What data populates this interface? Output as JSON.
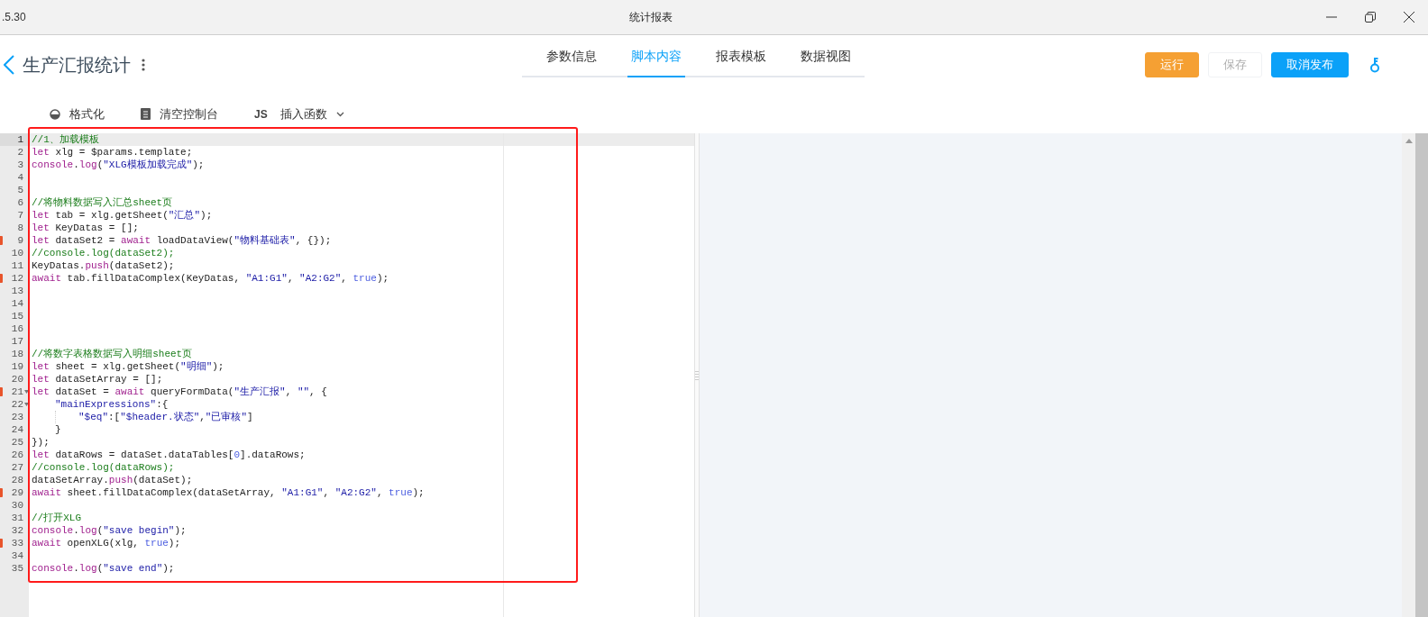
{
  "window": {
    "version": ".5.30",
    "title": "统计报表"
  },
  "header": {
    "title": "生产汇报统计"
  },
  "tabs": [
    {
      "label": "参数信息",
      "selected": false
    },
    {
      "label": "脚本内容",
      "selected": true
    },
    {
      "label": "报表模板",
      "selected": false
    },
    {
      "label": "数据视图",
      "selected": false
    }
  ],
  "buttons": [
    {
      "label": "运行",
      "kind": "warning",
      "disabled": false
    },
    {
      "label": "保存",
      "kind": "default",
      "disabled": true
    },
    {
      "label": "取消发布",
      "kind": "primary",
      "disabled": false
    }
  ],
  "toolbar": [
    {
      "kind": "format",
      "label": "格式化"
    },
    {
      "kind": "clear",
      "label": "清空控制台"
    },
    {
      "kind": "insert",
      "prefix": "JS",
      "label": "插入函数"
    }
  ],
  "editor": {
    "lines": [
      {
        "number": "1",
        "active": true,
        "marked": false,
        "foldable": false,
        "tokens": [
          {
            "kind": "comment",
            "text": "//1、加载模板"
          }
        ]
      },
      {
        "number": "2",
        "active": false,
        "marked": false,
        "foldable": false,
        "tokens": [
          {
            "kind": "keyword",
            "text": "let"
          },
          {
            "kind": "plain",
            "text": " xlg = $params.template;"
          }
        ]
      },
      {
        "number": "3",
        "active": false,
        "marked": false,
        "foldable": false,
        "tokens": [
          {
            "kind": "builtin",
            "text": "console"
          },
          {
            "kind": "plain",
            "text": "."
          },
          {
            "kind": "builtin",
            "text": "log"
          },
          {
            "kind": "plain",
            "text": "("
          },
          {
            "kind": "string",
            "text": "\"XLG模板加载完成\""
          },
          {
            "kind": "plain",
            "text": ");"
          }
        ]
      },
      {
        "number": "4",
        "active": false,
        "marked": false,
        "foldable": false
      },
      {
        "number": "5",
        "active": false,
        "marked": false,
        "foldable": false
      },
      {
        "number": "6",
        "active": false,
        "marked": false,
        "foldable": false,
        "tokens": [
          {
            "kind": "comment",
            "text": "//将物料数据写入汇总sheet页"
          }
        ]
      },
      {
        "number": "7",
        "active": false,
        "marked": false,
        "foldable": false,
        "tokens": [
          {
            "kind": "keyword",
            "text": "let"
          },
          {
            "kind": "plain",
            "text": " tab = xlg.getSheet("
          },
          {
            "kind": "string",
            "text": "\"汇总\""
          },
          {
            "kind": "plain",
            "text": ");"
          }
        ]
      },
      {
        "number": "8",
        "active": false,
        "marked": false,
        "foldable": false,
        "tokens": [
          {
            "kind": "keyword",
            "text": "let"
          },
          {
            "kind": "plain",
            "text": " KeyDatas = [];"
          }
        ]
      },
      {
        "number": "9",
        "active": false,
        "marked": true,
        "foldable": false,
        "tokens": [
          {
            "kind": "keyword",
            "text": "let"
          },
          {
            "kind": "plain",
            "text": " dataSet2 = "
          },
          {
            "kind": "keyword",
            "text": "await"
          },
          {
            "kind": "plain",
            "text": " loadDataView("
          },
          {
            "kind": "string",
            "text": "\"物料基础表\""
          },
          {
            "kind": "plain",
            "text": ", {});"
          }
        ]
      },
      {
        "number": "10",
        "active": false,
        "marked": false,
        "foldable": false,
        "tokens": [
          {
            "kind": "comment",
            "text": "//console.log(dataSet2);"
          }
        ]
      },
      {
        "number": "11",
        "active": false,
        "marked": false,
        "foldable": false,
        "tokens": [
          {
            "kind": "plain",
            "text": "KeyDatas."
          },
          {
            "kind": "builtin",
            "text": "push"
          },
          {
            "kind": "plain",
            "text": "(dataSet2);"
          }
        ]
      },
      {
        "number": "12",
        "active": false,
        "marked": true,
        "foldable": false,
        "tokens": [
          {
            "kind": "keyword",
            "text": "await"
          },
          {
            "kind": "plain",
            "text": " tab.fillDataComplex(KeyDatas, "
          },
          {
            "kind": "string",
            "text": "\"A1:G1\""
          },
          {
            "kind": "plain",
            "text": ", "
          },
          {
            "kind": "string",
            "text": "\"A2:G2\""
          },
          {
            "kind": "plain",
            "text": ", "
          },
          {
            "kind": "literal",
            "text": "true"
          },
          {
            "kind": "plain",
            "text": ");"
          }
        ]
      },
      {
        "number": "13",
        "active": false,
        "marked": false,
        "foldable": false
      },
      {
        "number": "14",
        "active": false,
        "marked": false,
        "foldable": false
      },
      {
        "number": "15",
        "active": false,
        "marked": false,
        "foldable": false
      },
      {
        "number": "16",
        "active": false,
        "marked": false,
        "foldable": false
      },
      {
        "number": "17",
        "active": false,
        "marked": false,
        "foldable": false
      },
      {
        "number": "18",
        "active": false,
        "marked": false,
        "foldable": false,
        "tokens": [
          {
            "kind": "comment",
            "text": "//将数字表格数据写入明细sheet页"
          }
        ]
      },
      {
        "number": "19",
        "active": false,
        "marked": false,
        "foldable": false,
        "tokens": [
          {
            "kind": "keyword",
            "text": "let"
          },
          {
            "kind": "plain",
            "text": " sheet = xlg.getSheet("
          },
          {
            "kind": "string",
            "text": "\"明细\""
          },
          {
            "kind": "plain",
            "text": ");"
          }
        ]
      },
      {
        "number": "20",
        "active": false,
        "marked": false,
        "foldable": false,
        "tokens": [
          {
            "kind": "keyword",
            "text": "let"
          },
          {
            "kind": "plain",
            "text": " dataSetArray = [];"
          }
        ]
      },
      {
        "number": "21",
        "active": false,
        "marked": true,
        "foldable": true,
        "tokens": [
          {
            "kind": "keyword",
            "text": "let"
          },
          {
            "kind": "plain",
            "text": " dataSet = "
          },
          {
            "kind": "keyword",
            "text": "await"
          },
          {
            "kind": "plain",
            "text": " queryFormData("
          },
          {
            "kind": "string",
            "text": "\"生产汇报\""
          },
          {
            "kind": "plain",
            "text": ", "
          },
          {
            "kind": "string",
            "text": "\"\""
          },
          {
            "kind": "plain",
            "text": ", {"
          }
        ],
        "children": [
          {
            "number": "22",
            "active": false,
            "marked": false,
            "foldable": true,
            "tokens": [
              {
                "kind": "string",
                "text": "\"mainExpressions\""
              },
              {
                "kind": "plain",
                "text": ":{"
              }
            ],
            "children": [
              {
                "number": "23",
                "active": false,
                "marked": false,
                "foldable": false,
                "tokens": [
                  {
                    "kind": "string",
                    "text": "\"$eq\""
                  },
                  {
                    "kind": "plain",
                    "text": ":["
                  },
                  {
                    "kind": "string",
                    "text": "\"$header.状态\""
                  },
                  {
                    "kind": "plain",
                    "text": ","
                  },
                  {
                    "kind": "string",
                    "text": "\"已审核\""
                  },
                  {
                    "kind": "plain",
                    "text": "]"
                  }
                ]
              }
            ]
          },
          {
            "number": "24",
            "active": false,
            "marked": false,
            "foldable": false,
            "tokens": [
              {
                "kind": "plain",
                "text": "}"
              }
            ]
          }
        ]
      },
      {
        "number": "25",
        "active": false,
        "marked": false,
        "foldable": false,
        "tokens": [
          {
            "kind": "plain",
            "text": "});"
          }
        ]
      },
      {
        "number": "26",
        "active": false,
        "marked": false,
        "foldable": false,
        "tokens": [
          {
            "kind": "keyword",
            "text": "let"
          },
          {
            "kind": "plain",
            "text": " dataRows = dataSet.dataTables["
          },
          {
            "kind": "literal",
            "text": "0"
          },
          {
            "kind": "plain",
            "text": "].dataRows;"
          }
        ]
      },
      {
        "number": "27",
        "active": false,
        "marked": false,
        "foldable": false,
        "tokens": [
          {
            "kind": "comment",
            "text": "//console.log(dataRows);"
          }
        ]
      },
      {
        "number": "28",
        "active": false,
        "marked": false,
        "foldable": false,
        "tokens": [
          {
            "kind": "plain",
            "text": "dataSetArray."
          },
          {
            "kind": "builtin",
            "text": "push"
          },
          {
            "kind": "plain",
            "text": "(dataSet);"
          }
        ]
      },
      {
        "number": "29",
        "active": false,
        "marked": true,
        "foldable": false,
        "tokens": [
          {
            "kind": "keyword",
            "text": "await"
          },
          {
            "kind": "plain",
            "text": " sheet.fillDataComplex(dataSetArray, "
          },
          {
            "kind": "string",
            "text": "\"A1:G1\""
          },
          {
            "kind": "plain",
            "text": ", "
          },
          {
            "kind": "string",
            "text": "\"A2:G2\""
          },
          {
            "kind": "plain",
            "text": ", "
          },
          {
            "kind": "literal",
            "text": "true"
          },
          {
            "kind": "plain",
            "text": ");"
          }
        ]
      },
      {
        "number": "30",
        "active": false,
        "marked": false,
        "foldable": false
      },
      {
        "number": "31",
        "active": false,
        "marked": false,
        "foldable": false,
        "tokens": [
          {
            "kind": "comment",
            "text": "//打开XLG"
          }
        ]
      },
      {
        "number": "32",
        "active": false,
        "marked": false,
        "foldable": false,
        "tokens": [
          {
            "kind": "builtin",
            "text": "console"
          },
          {
            "kind": "plain",
            "text": "."
          },
          {
            "kind": "builtin",
            "text": "log"
          },
          {
            "kind": "plain",
            "text": "("
          },
          {
            "kind": "string",
            "text": "\"save begin\""
          },
          {
            "kind": "plain",
            "text": ");"
          }
        ]
      },
      {
        "number": "33",
        "active": false,
        "marked": true,
        "foldable": false,
        "tokens": [
          {
            "kind": "keyword",
            "text": "await"
          },
          {
            "kind": "plain",
            "text": " openXLG(xlg, "
          },
          {
            "kind": "literal",
            "text": "true"
          },
          {
            "kind": "plain",
            "text": ");"
          }
        ]
      },
      {
        "number": "34",
        "active": false,
        "marked": false,
        "foldable": false
      },
      {
        "number": "35",
        "active": false,
        "marked": false,
        "foldable": false,
        "tokens": [
          {
            "kind": "builtin",
            "text": "console"
          },
          {
            "kind": "plain",
            "text": "."
          },
          {
            "kind": "builtin",
            "text": "log"
          },
          {
            "kind": "plain",
            "text": "("
          },
          {
            "kind": "string",
            "text": "\"save end\""
          },
          {
            "kind": "plain",
            "text": ");"
          }
        ]
      }
    ]
  }
}
